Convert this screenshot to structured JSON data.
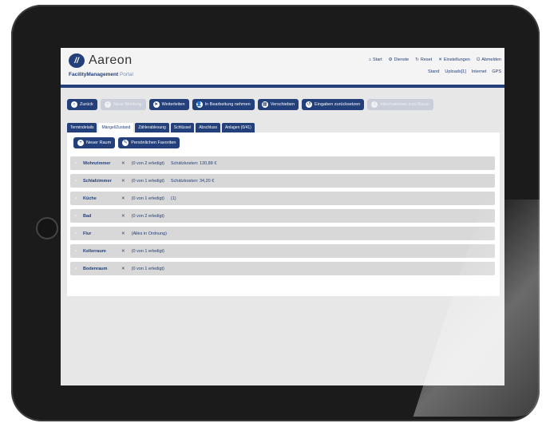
{
  "app": {
    "logo_text": "Aareon",
    "subtitle_main": "FacilityManagement",
    "subtitle_suffix": "Portal"
  },
  "topnav": [
    {
      "icon": "home-icon",
      "glyph": "⌂",
      "label": "Start"
    },
    {
      "icon": "services-icon",
      "glyph": "⚙",
      "label": "Dienste"
    },
    {
      "icon": "reset-icon",
      "glyph": "↻",
      "label": "Reset"
    },
    {
      "icon": "settings-icon",
      "glyph": "✕",
      "label": "Einstellungen"
    },
    {
      "icon": "logout-icon",
      "glyph": "⏻",
      "label": "Abmelden"
    }
  ],
  "status": {
    "stand_label": "Stand",
    "uploads_label": "Uploads[1]",
    "internet_label": "Internet",
    "gps_label": "GPS"
  },
  "actions": [
    {
      "name": "back-button",
      "icon": "back-icon",
      "glyph": "‹",
      "label": "Zurück",
      "enabled": true
    },
    {
      "name": "new-entry-button",
      "icon": "new-entry-icon",
      "glyph": "+",
      "label": "Neue Meldung",
      "enabled": false
    },
    {
      "name": "forward-button",
      "icon": "forward-icon",
      "glyph": "➤",
      "label": "Weiterleiten",
      "enabled": true
    },
    {
      "name": "take-over-button",
      "icon": "person-icon",
      "glyph": "👤",
      "label": "In Bearbeitung nehmen",
      "enabled": true
    },
    {
      "name": "move-button",
      "icon": "calendar-icon",
      "glyph": "▦",
      "label": "Verschieben",
      "enabled": true
    },
    {
      "name": "reset-input-button",
      "icon": "undo-icon",
      "glyph": "↺",
      "label": "Eingaben zurücksetzen",
      "enabled": true
    },
    {
      "name": "info-button",
      "icon": "info-icon",
      "glyph": "i",
      "label": "Informationen zum Raum",
      "enabled": false
    }
  ],
  "tabs": [
    {
      "label": "Termindetails",
      "active": false
    },
    {
      "label": "Mängel/Zustand",
      "active": true
    },
    {
      "label": "Zählerablesung",
      "active": false
    },
    {
      "label": "Schlüssel",
      "active": false
    },
    {
      "label": "Abschluss",
      "active": false
    },
    {
      "label": "Anlagen (0/41)",
      "active": false
    }
  ],
  "panel_actions": [
    {
      "name": "new-room-button",
      "icon": "plus-icon",
      "glyph": "+",
      "label": "Neuer Raum"
    },
    {
      "name": "favorites-button",
      "icon": "pencil-icon",
      "glyph": "✎",
      "label": "Persönlichen Favoriten"
    }
  ],
  "rooms": [
    {
      "name": "Wohnzimmer",
      "done": "(0 von 2 erledigt)",
      "cost": "Schätzkosten: 130,88 €"
    },
    {
      "name": "Schlafzimmer",
      "done": "(0 von 1 erledigt)",
      "cost": "Schätzkosten: 34,20 €"
    },
    {
      "name": "Küche",
      "done": "(0 von 1 erledigt)",
      "cost": "(1)"
    },
    {
      "name": "Bad",
      "done": "(0 von 2 erledigt)",
      "cost": ""
    },
    {
      "name": "Flur",
      "done": "(Alles in Ordnung)",
      "cost": ""
    },
    {
      "name": "Kellerraum",
      "done": "(0 von 1 erledigt)",
      "cost": ""
    },
    {
      "name": "Bodenraum",
      "done": "(0 von 1 erledigt)",
      "cost": ""
    }
  ]
}
